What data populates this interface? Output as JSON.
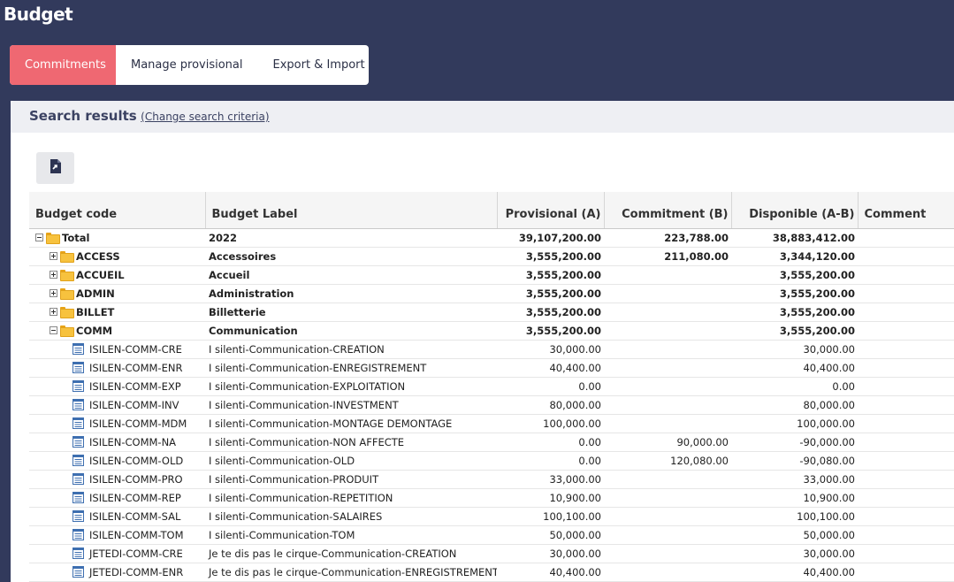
{
  "app": {
    "title": "Budget"
  },
  "tabs": [
    {
      "label": "Commitments",
      "active": true
    },
    {
      "label": "Manage provisional",
      "active": false
    },
    {
      "label": "Export & Import",
      "active": false
    }
  ],
  "results": {
    "title": "Search results",
    "change_link": "(Change search criteria)",
    "export_icon": "file-export-icon"
  },
  "colors": {
    "header_bg": "#323a5c",
    "active_tab": "#ef6872",
    "folder": "#f7c23e",
    "doc_icon": "#3e6fb0"
  },
  "table": {
    "columns": [
      "Budget code",
      "Budget Label",
      "Provisional (A)",
      "Commitment (B)",
      "Disponible (A-B)",
      "Comment"
    ],
    "rows": [
      {
        "level": 0,
        "type": "folder",
        "toggle": "minus",
        "code": "Total",
        "label": "2022",
        "provisional": "39,107,200.00",
        "commitment": "223,788.00",
        "disponible": "38,883,412.00",
        "comment": ""
      },
      {
        "level": 1,
        "type": "folder",
        "toggle": "plus",
        "code": "ACCESS",
        "label": "Accessoires",
        "provisional": "3,555,200.00",
        "commitment": "211,080.00",
        "disponible": "3,344,120.00",
        "comment": ""
      },
      {
        "level": 1,
        "type": "folder",
        "toggle": "plus",
        "code": "ACCUEIL",
        "label": "Accueil",
        "provisional": "3,555,200.00",
        "commitment": "",
        "disponible": "3,555,200.00",
        "comment": ""
      },
      {
        "level": 1,
        "type": "folder",
        "toggle": "plus",
        "code": "ADMIN",
        "label": "Administration",
        "provisional": "3,555,200.00",
        "commitment": "",
        "disponible": "3,555,200.00",
        "comment": ""
      },
      {
        "level": 1,
        "type": "folder",
        "toggle": "plus",
        "code": "BILLET",
        "label": "Billetterie",
        "provisional": "3,555,200.00",
        "commitment": "",
        "disponible": "3,555,200.00",
        "comment": ""
      },
      {
        "level": 1,
        "type": "folder",
        "toggle": "minus",
        "code": "COMM",
        "label": "Communication",
        "provisional": "3,555,200.00",
        "commitment": "",
        "disponible": "3,555,200.00",
        "comment": ""
      },
      {
        "level": 2,
        "type": "leaf",
        "code": "ISILEN-COMM-CRE",
        "label": "I silenti-Communication-CREATION",
        "provisional": "30,000.00",
        "commitment": "",
        "disponible": "30,000.00",
        "comment": ""
      },
      {
        "level": 2,
        "type": "leaf",
        "code": "ISILEN-COMM-ENR",
        "label": "I silenti-Communication-ENREGISTREMENT",
        "provisional": "40,400.00",
        "commitment": "",
        "disponible": "40,400.00",
        "comment": ""
      },
      {
        "level": 2,
        "type": "leaf",
        "code": "ISILEN-COMM-EXP",
        "label": "I silenti-Communication-EXPLOITATION",
        "provisional": "0.00",
        "commitment": "",
        "disponible": "0.00",
        "comment": ""
      },
      {
        "level": 2,
        "type": "leaf",
        "code": "ISILEN-COMM-INV",
        "label": "I silenti-Communication-INVESTMENT",
        "provisional": "80,000.00",
        "commitment": "",
        "disponible": "80,000.00",
        "comment": ""
      },
      {
        "level": 2,
        "type": "leaf",
        "code": "ISILEN-COMM-MDM",
        "label": "I silenti-Communication-MONTAGE DEMONTAGE",
        "provisional": "100,000.00",
        "commitment": "",
        "disponible": "100,000.00",
        "comment": ""
      },
      {
        "level": 2,
        "type": "leaf",
        "code": "ISILEN-COMM-NA",
        "label": "I silenti-Communication-NON AFFECTE",
        "provisional": "0.00",
        "commitment": "90,000.00",
        "disponible": "-90,000.00",
        "comment": ""
      },
      {
        "level": 2,
        "type": "leaf",
        "code": "ISILEN-COMM-OLD",
        "label": "I silenti-Communication-OLD",
        "provisional": "0.00",
        "commitment": "120,080.00",
        "disponible": "-90,080.00",
        "comment": ""
      },
      {
        "level": 2,
        "type": "leaf",
        "code": "ISILEN-COMM-PRO",
        "label": "I silenti-Communication-PRODUIT",
        "provisional": "33,000.00",
        "commitment": "",
        "disponible": "33,000.00",
        "comment": ""
      },
      {
        "level": 2,
        "type": "leaf",
        "code": "ISILEN-COMM-REP",
        "label": "I silenti-Communication-REPETITION",
        "provisional": "10,900.00",
        "commitment": "",
        "disponible": "10,900.00",
        "comment": ""
      },
      {
        "level": 2,
        "type": "leaf",
        "code": "ISILEN-COMM-SAL",
        "label": "I silenti-Communication-SALAIRES",
        "provisional": "100,100.00",
        "commitment": "",
        "disponible": "100,100.00",
        "comment": ""
      },
      {
        "level": 2,
        "type": "leaf",
        "code": "ISILEN-COMM-TOM",
        "label": "I silenti-Communication-TOM",
        "provisional": "50,000.00",
        "commitment": "",
        "disponible": "50,000.00",
        "comment": ""
      },
      {
        "level": 2,
        "type": "leaf",
        "code": "JETEDI-COMM-CRE",
        "label": "Je te dis pas le cirque-Communication-CREATION",
        "provisional": "30,000.00",
        "commitment": "",
        "disponible": "30,000.00",
        "comment": ""
      },
      {
        "level": 2,
        "type": "leaf",
        "code": "JETEDI-COMM-ENR",
        "label": "Je te dis pas le cirque-Communication-ENREGISTREMENT",
        "provisional": "40,400.00",
        "commitment": "",
        "disponible": "40,400.00",
        "comment": ""
      }
    ]
  }
}
